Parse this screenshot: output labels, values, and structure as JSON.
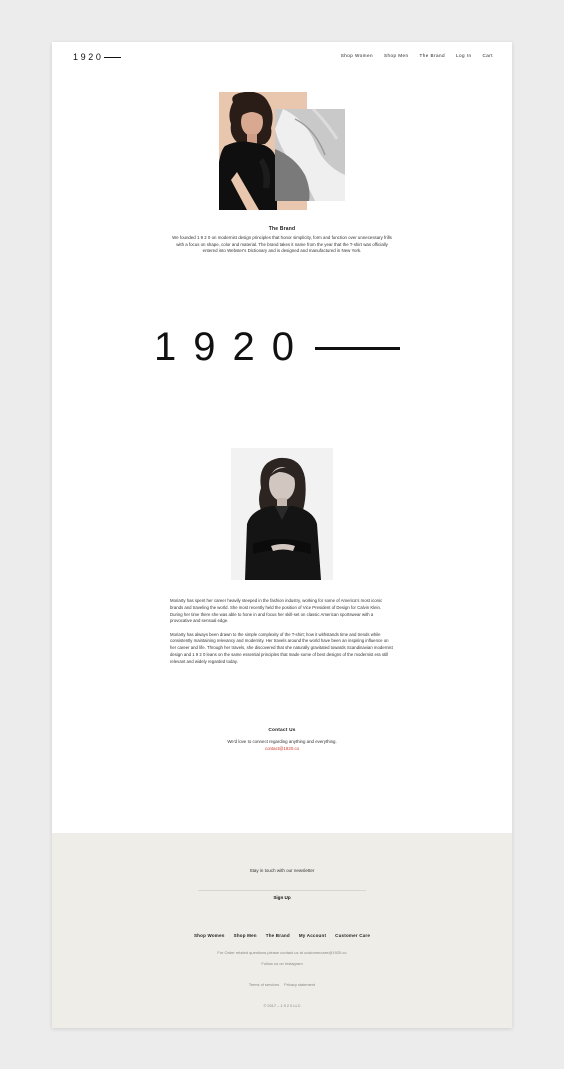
{
  "header": {
    "logo_text": "1920",
    "nav": [
      "Shop Women",
      "Shop Men",
      "The Brand",
      "Log In",
      "Cart"
    ]
  },
  "brand": {
    "title": "The Brand",
    "body": "We founded 1 9 2 0 on modernist design principles that honor simplicity, form and function over unnecessary frills with a focus on shape, color and material. The brand takes it name from the year that the T-shirt was officially entered into Webster's Dictionary and is designed and manufactured in New York."
  },
  "big_logo": {
    "text": "1920"
  },
  "bio": {
    "paragraphs": [
      "Moriarty has spent her career heavily steeped in the fashion industry, working for some of America's most iconic brands and traveling the world. She most recently held the position of Vice President of Design for Calvin Klein. During her time there she was able to hone in and focus her skill-set on classic American sportswear with a provocative and sensual edge.",
      "Moriarty has always been drawn to the simple complexity of the T-shirt; how it withstands time and trends while consistently maintaining relevancy and modernity. Her travels around the world have been an inspiring influence on her career and life. Through her travels, she discovered that she naturally gravitated towards Scandinavian modernist design and 1 9 2 0 leans on the same essential principles that made some of best designs of the modernist era still relevant and widely regarded today."
    ]
  },
  "contact": {
    "title": "Contact Us",
    "line": "We'd love to connect regarding anything and everything.",
    "email": "contact@1920.co"
  },
  "footer": {
    "newsletter": "Stay in touch with our newsletter",
    "signup": "Sign Up",
    "nav": [
      "Shop Women",
      "Shop Men",
      "The Brand",
      "My Account",
      "Customer Care"
    ],
    "order_line": "For Order related questions please contact us at customercare@1920.co",
    "instagram": "Follow us on Instagram",
    "terms": "Terms of services",
    "privacy": "Privacy statement",
    "copyright": "© 2017 – 1 9 2 0 LLC"
  },
  "colors": {
    "background": "#ececec",
    "page": "#ffffff",
    "footer": "#efede7",
    "accent_link": "#d0392c",
    "hero_peach": "#e9c7ae"
  }
}
